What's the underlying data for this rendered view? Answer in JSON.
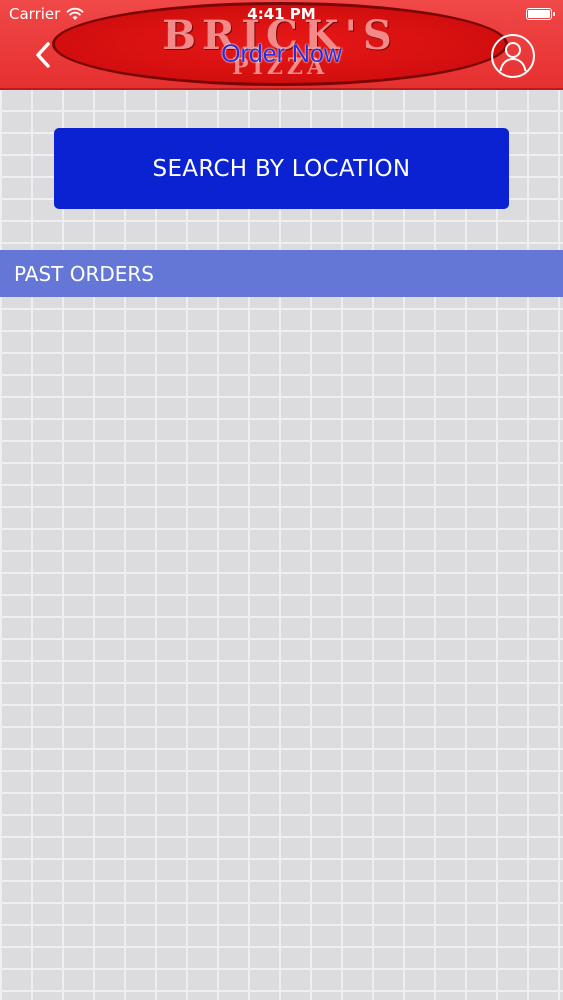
{
  "status_bar": {
    "carrier": "Carrier",
    "time": "4:41 PM"
  },
  "header": {
    "logo_brand": "BRICK'S",
    "logo_sub": "PIZZA",
    "title": "Order Now",
    "back_icon": "chevron-left-icon",
    "profile_icon": "user-circle-icon"
  },
  "main": {
    "search_button_label": "SEARCH BY LOCATION",
    "past_orders_label": "PAST ORDERS",
    "past_orders": []
  },
  "colors": {
    "header_red": "#e63030",
    "search_button_blue": "#0a22d1",
    "section_header_blue": "#6577d6",
    "title_blue": "#2b2bd6"
  }
}
